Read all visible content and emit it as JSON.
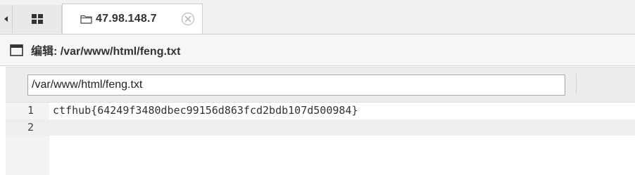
{
  "tabs": {
    "scroll_left_icon": "caret-left-icon",
    "grid_icon": "grid-icon",
    "site_tab": {
      "icon": "folder-icon",
      "title": "47.98.148.7",
      "close_icon": "close-circle-icon"
    }
  },
  "panel": {
    "icon": "window-icon",
    "title": "编辑: /var/www/html/feng.txt"
  },
  "path_bar": {
    "value": "/var/www/html/feng.txt"
  },
  "editor": {
    "lines": [
      {
        "number": "1",
        "text": "ctfhub{64249f3480dbec99156d863fcd2bdb107d500984}"
      },
      {
        "number": "2",
        "text": ""
      }
    ],
    "active_line": 2
  },
  "colors": {
    "tabbar_bg": "#f1f1f1",
    "panel_header_bg": "#f6f6f6",
    "toolbar_bg": "#ededed",
    "gutter_bg": "#f3f3f3",
    "active_line_bg": "#eeeeee",
    "text": "#333333"
  }
}
